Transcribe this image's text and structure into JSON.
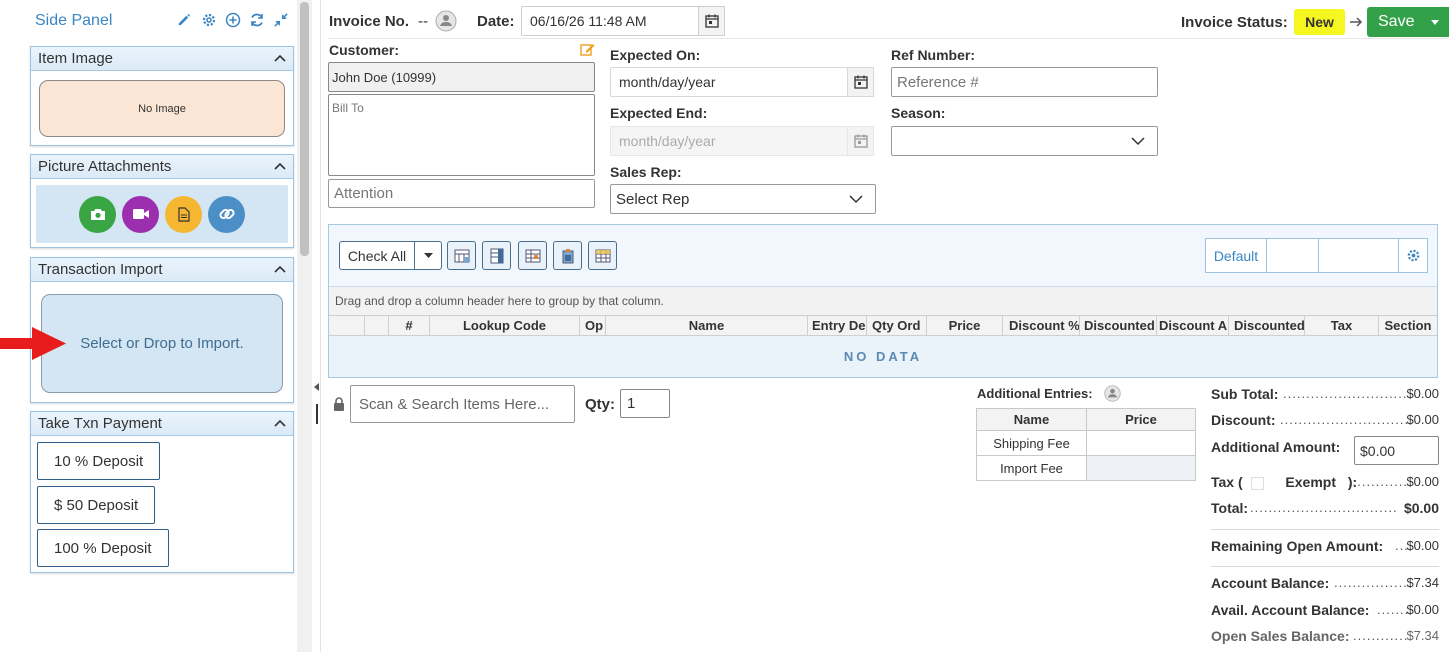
{
  "side_panel": {
    "title": "Side Panel",
    "item_image": {
      "title": "Item Image",
      "placeholder": "No Image"
    },
    "picture_attachments": {
      "title": "Picture Attachments",
      "buttons": [
        {
          "icon": "camera-icon",
          "color": "#3aa544"
        },
        {
          "icon": "video-icon",
          "color": "#9b2fae"
        },
        {
          "icon": "document-icon",
          "color": "#f5b731"
        },
        {
          "icon": "link-icon",
          "color": "#4c8fc7"
        }
      ]
    },
    "transaction_import": {
      "title": "Transaction Import",
      "dropzone": "Select or Drop to Import."
    },
    "take_payment": {
      "title": "Take Txn Payment",
      "buttons": [
        "10 % Deposit",
        "$ 50 Deposit",
        "100 % Deposit"
      ]
    }
  },
  "header": {
    "invoice_no_label": "Invoice No.",
    "invoice_no_value": "--",
    "date_label": "Date:",
    "date_value": "06/16/26 11:48 AM",
    "status_label": "Invoice Status:",
    "status_value": "New",
    "save_label": "Save",
    "colors": {
      "save": "#33a04a",
      "status": "#f6f620"
    }
  },
  "form": {
    "customer_label": "Customer:",
    "customer_value": "John Doe (10999)",
    "bill_to_placeholder": "Bill To",
    "attention_placeholder": "Attention",
    "expected_on_label": "Expected On:",
    "expected_on_placeholder": "month/day/year",
    "expected_end_label": "Expected End:",
    "expected_end_placeholder": "month/day/year",
    "sales_rep_label": "Sales Rep:",
    "sales_rep_value": "Select Rep",
    "ref_number_label": "Ref Number:",
    "ref_number_placeholder": "Reference #",
    "season_label": "Season:",
    "season_value": ""
  },
  "grid": {
    "check_all": "Check All",
    "view_default": "Default",
    "group_hint": "Drag and drop a column header here to group by that column.",
    "columns": [
      "",
      "",
      "#",
      "Lookup Code",
      "Op",
      "Name",
      "Entry De",
      "Qty Ord",
      "Price",
      "Discount %",
      "Discounted",
      "Discount A",
      "Discounted",
      "Tax",
      "Section"
    ],
    "no_data": "NO DATA"
  },
  "scan": {
    "placeholder": "Scan & Search Items Here...",
    "qty_label": "Qty:",
    "qty_value": "1"
  },
  "additional_entries": {
    "title": "Additional Entries:",
    "headers": [
      "Name",
      "Price"
    ],
    "rows": [
      [
        "Shipping Fee",
        ""
      ],
      [
        "Import Fee",
        ""
      ]
    ]
  },
  "totals": {
    "sub_total_label": "Sub Total:",
    "sub_total": "$0.00",
    "discount_label": "Discount:",
    "discount": "$0.00",
    "additional_amount_label": "Additional Amount:",
    "additional_amount": "$0.00",
    "tax_label_open": "Tax (",
    "exempt_label": "Exempt",
    "tax_label_close": "):",
    "tax": "$0.00",
    "total_label": "Total:",
    "total": "$0.00",
    "remaining_label": "Remaining Open Amount:",
    "remaining": "$0.00",
    "account_balance_label": "Account Balance:",
    "account_balance": "$7.34",
    "avail_balance_label": "Avail. Account Balance:",
    "avail_balance": "$0.00",
    "open_sales_label": "Open Sales Balance:",
    "open_sales": "$7.34"
  }
}
